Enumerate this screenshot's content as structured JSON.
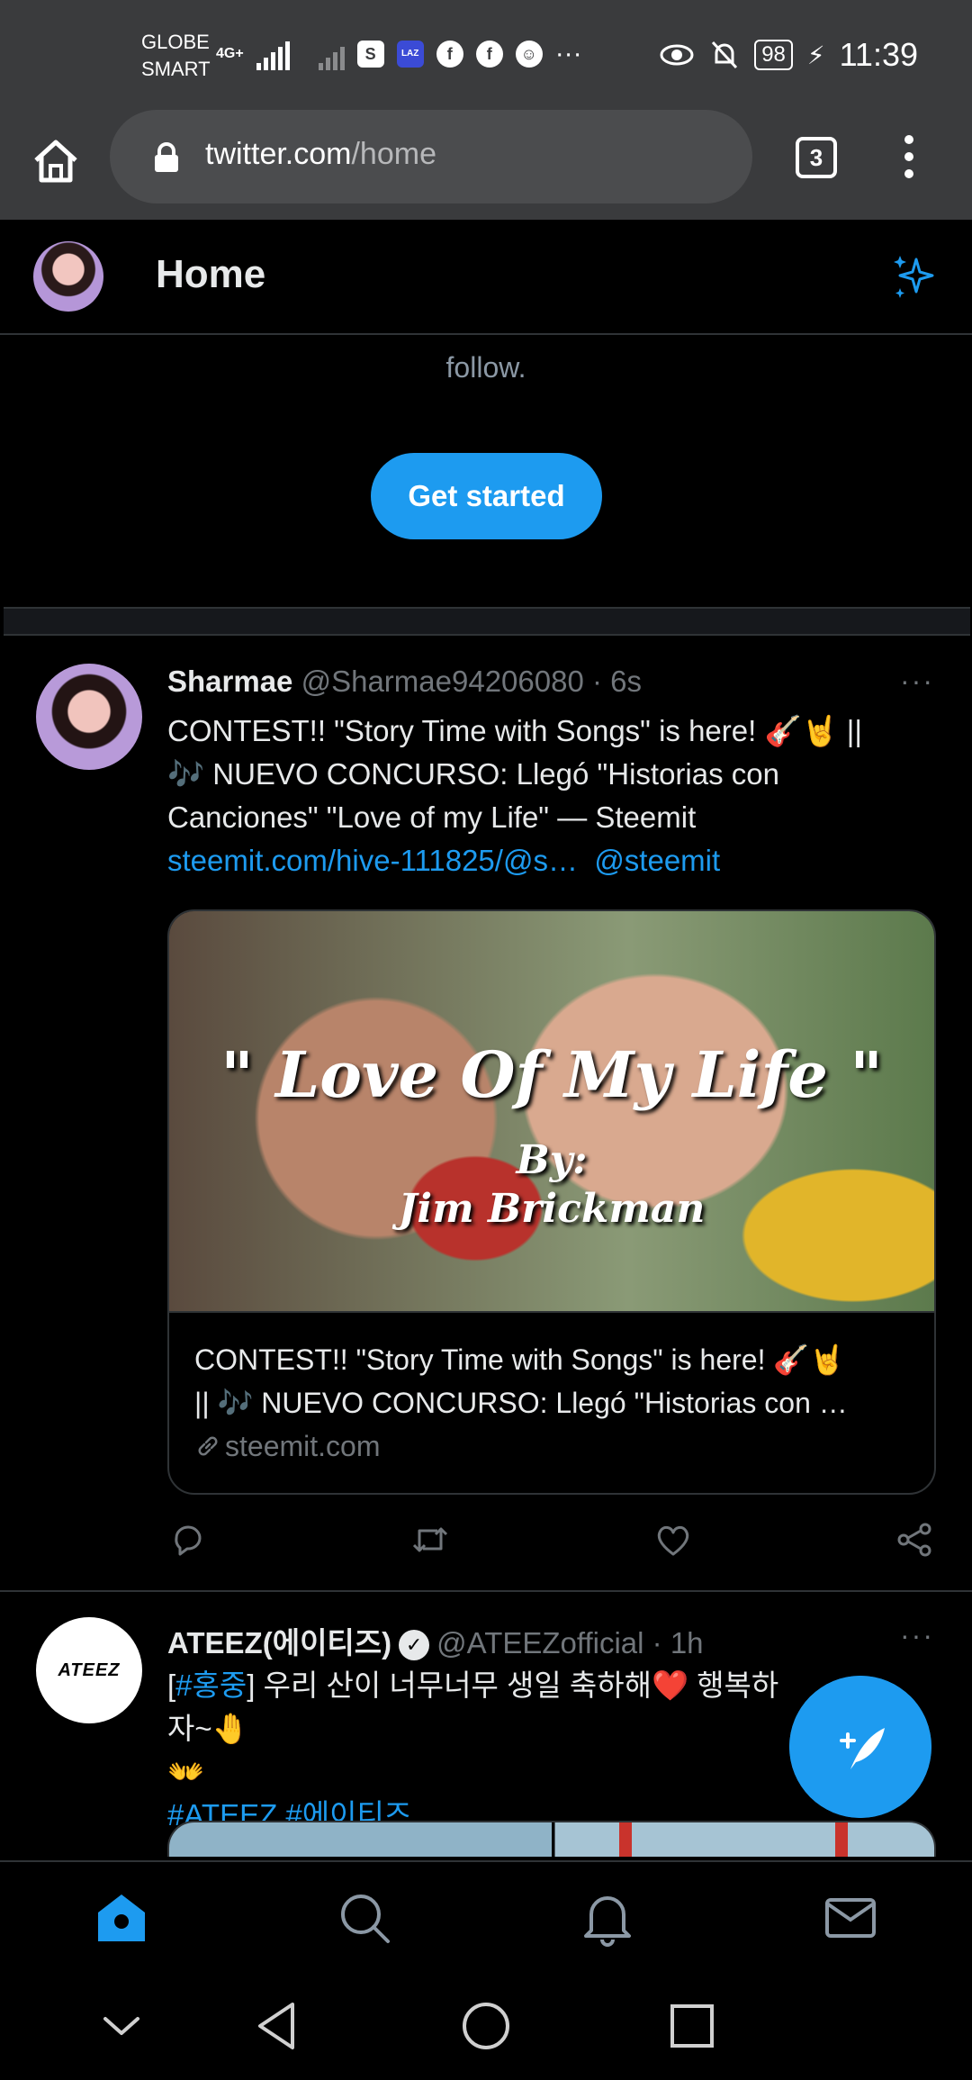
{
  "status_bar": {
    "carrier_line1": "GLOBE",
    "carrier_line2": "SMART",
    "network": "4G+",
    "more": "···",
    "battery": "98",
    "time": "11:39"
  },
  "browser": {
    "url_domain": "twitter.com",
    "url_path": "/home",
    "tab_count": "3"
  },
  "header": {
    "title": "Home"
  },
  "feed": {
    "follow_text": "follow.",
    "get_started_label": "Get started"
  },
  "tweets": [
    {
      "name": "Sharmae",
      "handle": "@Sharmae94206080",
      "time": "· 6s",
      "more": "···",
      "text_line1": "CONTEST!! \"Story Time with Songs\" is here! 🎸🤘 ||",
      "text_line2": "🎶 NUEVO CONCURSO: Llegó \"Historias con",
      "text_line3": "Canciones\"  \"Love of my Life\" — Steemit",
      "link_url": "steemit.com/hive-111825/@s…",
      "link_mention": "@steemit",
      "card": {
        "image_title": "\" Love Of My Life \"",
        "image_by": "By:",
        "image_artist": "Jim Brickman",
        "title_line1": "CONTEST!! \"Story Time with Songs\" is here! 🎸🤘",
        "title_line2": "|| 🎶 NUEVO CONCURSO: Llegó \"Historias con …",
        "domain": "steemit.com"
      }
    },
    {
      "name": "ATEEZ(에이티즈)",
      "handle": "@ATEEZofficial",
      "time": "· 1h",
      "more": "···",
      "avatar_text": "ATEEZ",
      "text_open": "[",
      "text_hashtag": "#홍중",
      "text_rest": "] 우리 산이 너무너무 생일 축하해❤️ 행복하자~🤚",
      "text_line2": "👐",
      "hashtags": "#ATEEZ #에이티즈"
    }
  ],
  "colors": {
    "accent": "#1d9bf0",
    "background": "#000000",
    "browser_chrome": "#3a3b3d",
    "muted_text": "#71767b"
  },
  "icons": {
    "browser": [
      "home-icon",
      "lock-icon",
      "tabs-icon",
      "more-vert-icon"
    ],
    "header": [
      "sparkle-icon"
    ],
    "tweet_actions": [
      "reply-icon",
      "retweet-icon",
      "like-icon",
      "share-icon"
    ],
    "bottom_nav": [
      "home-icon",
      "search-icon",
      "notifications-icon",
      "messages-icon"
    ],
    "system_nav": [
      "chevron-down-icon",
      "back-icon",
      "home-circle-icon",
      "recents-icon"
    ]
  }
}
